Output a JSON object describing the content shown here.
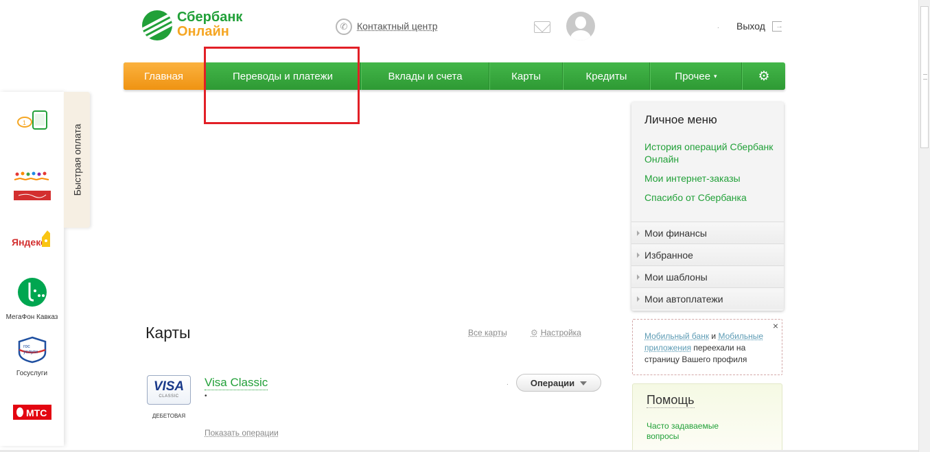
{
  "header": {
    "logo_line1": "Сбербанк",
    "logo_line2": "Онлайн",
    "contact_center": "Контактный центр",
    "user_dot": ".",
    "logout": "Выход"
  },
  "nav": {
    "items": [
      {
        "label": "Главная"
      },
      {
        "label": "Переводы и платежи"
      },
      {
        "label": "Вклады и счета"
      },
      {
        "label": "Карты"
      },
      {
        "label": "Кредиты"
      },
      {
        "label": "Прочее"
      }
    ],
    "other_arrow": "▾",
    "settings_icon": "gear-icon"
  },
  "quick_pay": {
    "tab_label": "Быстрая оплата",
    "items": [
      {
        "name": "tablet-payment-icon",
        "caption": ""
      },
      {
        "name": "charity-logo",
        "caption": ""
      },
      {
        "name": "yandex-logo",
        "logo_text": "Яндекс",
        "caption": ""
      },
      {
        "name": "megafon-logo",
        "caption": "МегаФон Кавказ"
      },
      {
        "name": "gosuslugi-logo",
        "logo_text": "гос услуги",
        "caption": "Госуслуги"
      },
      {
        "name": "mts-logo",
        "logo_text": "МТС",
        "caption": ""
      }
    ]
  },
  "cards": {
    "heading": "Карты",
    "all_cards": "Все карты",
    "settings": "Настройка",
    "card": {
      "brand": "VISA",
      "brand_sub": "CLASSIC",
      "type_label": "ДЕБЕТОВАЯ",
      "name": "Visa Classic",
      "sub": "•",
      "amount_dot": ".",
      "operations_button": "Операции",
      "show_operations": "Показать операции"
    }
  },
  "personal_menu": {
    "title": "Личное меню",
    "links": [
      {
        "label": "История операций Сбербанк Онлайн"
      },
      {
        "label": "Мои интернет-заказы"
      },
      {
        "label": "Спасибо от Сбербанка"
      }
    ],
    "sections": [
      {
        "label": "Мои финансы"
      },
      {
        "label": "Избранное"
      },
      {
        "label": "Мои шаблоны"
      },
      {
        "label": "Мои автоплатежи"
      }
    ]
  },
  "notice": {
    "link1": "Мобильный банк",
    "conj": " и ",
    "link2": "Мобильные приложения",
    "text": " переехали на страницу Вашего профиля",
    "close": "×"
  },
  "help": {
    "title": "Помощь",
    "faq_link": "Часто задаваемые вопросы"
  },
  "colors": {
    "brand_green": "#21a038",
    "home_orange": "#f5a623",
    "highlight_red": "#e21f26"
  }
}
